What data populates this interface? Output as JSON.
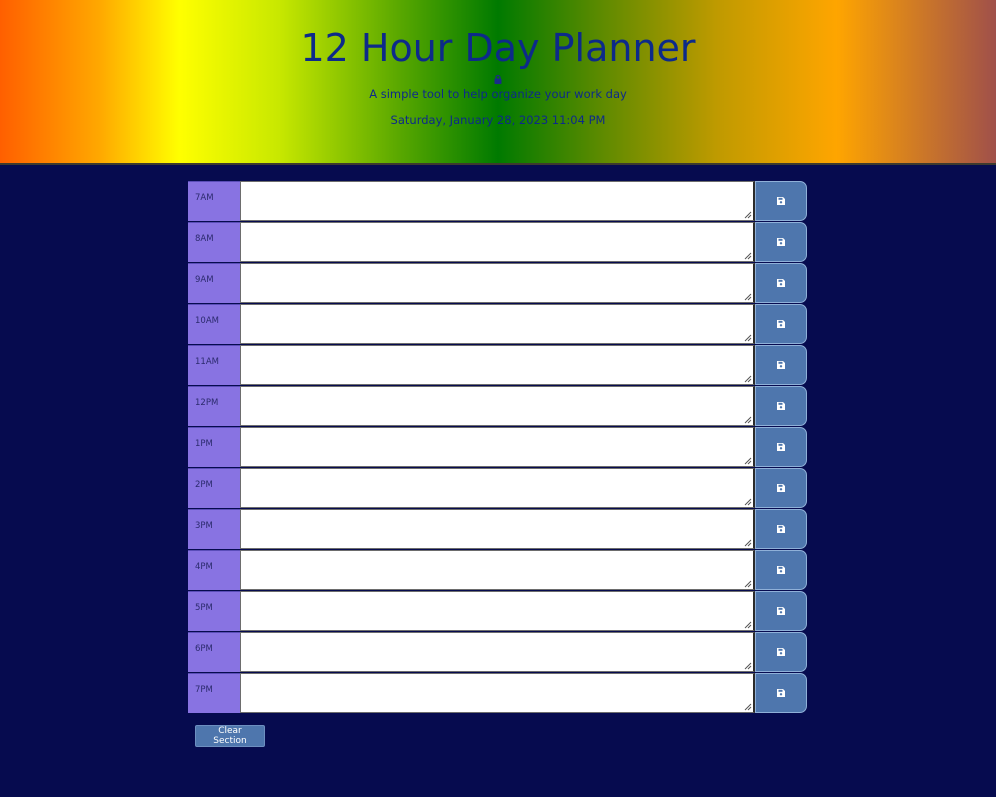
{
  "header": {
    "title": "12 Hour Day Planner",
    "lead": "A simple tool to help organize your work day",
    "current_day": "Saturday, January 28, 2023 11:04 PM",
    "lock_icon": "lock-icon"
  },
  "colors": {
    "page_background": "#060b4f",
    "hour_block": "#8873e2",
    "save_button": "#4e76ad",
    "title_text": "#0d2a8a"
  },
  "time_blocks": [
    {
      "hour": "7AM",
      "text": ""
    },
    {
      "hour": "8AM",
      "text": ""
    },
    {
      "hour": "9AM",
      "text": ""
    },
    {
      "hour": "10AM",
      "text": ""
    },
    {
      "hour": "11AM",
      "text": ""
    },
    {
      "hour": "12PM",
      "text": ""
    },
    {
      "hour": "1PM",
      "text": ""
    },
    {
      "hour": "2PM",
      "text": ""
    },
    {
      "hour": "3PM",
      "text": ""
    },
    {
      "hour": "4PM",
      "text": ""
    },
    {
      "hour": "5PM",
      "text": ""
    },
    {
      "hour": "6PM",
      "text": ""
    },
    {
      "hour": "7PM",
      "text": ""
    }
  ],
  "save_icon": "floppy-disk-icon",
  "clear_button_label": "Clear Section"
}
